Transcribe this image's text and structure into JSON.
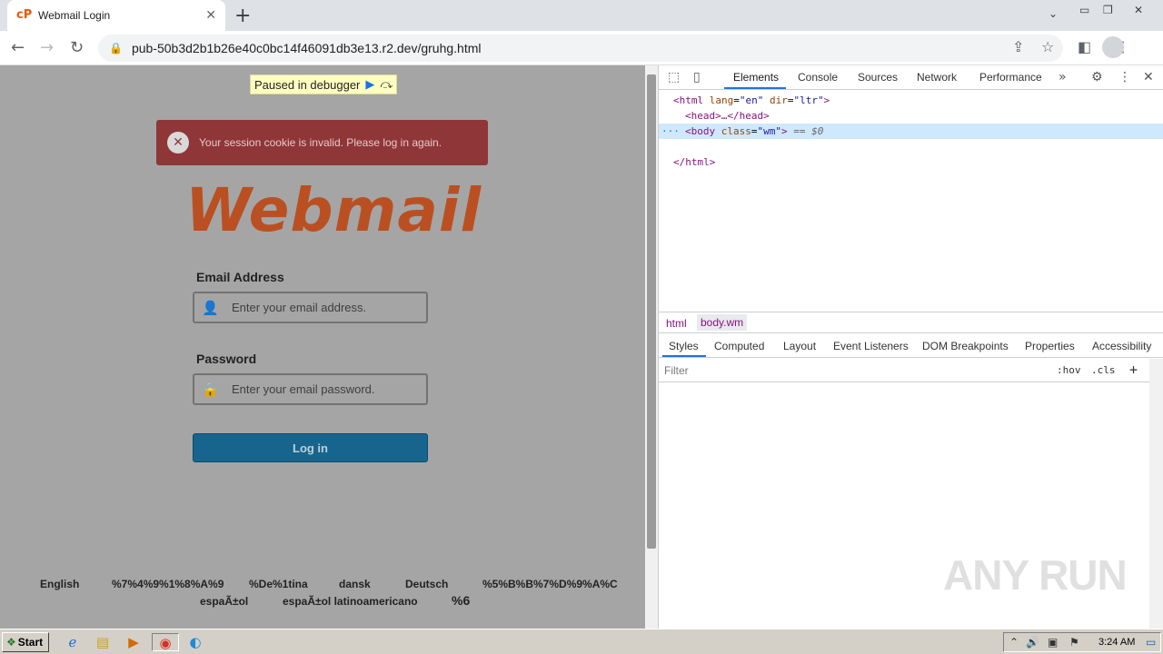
{
  "browser": {
    "tab_title": "Webmail Login",
    "tab_favicon": "cP",
    "url": "pub-50b3d2b1b26e40c0bc14f46091db3e13.r2.dev/gruhg.html"
  },
  "page": {
    "debugger_banner": "Paused in debugger",
    "alert_message": "Your session cookie is invalid. Please log in again.",
    "logo_text": "Webmail",
    "email_label": "Email Address",
    "email_placeholder": "Enter your email address.",
    "password_label": "Password",
    "password_placeholder": "Enter your email password.",
    "login_button": "Log in",
    "languages": [
      "English",
      "%7%4%9%1%8%A%9",
      "%De%1tina",
      "dansk",
      "Deutsch",
      "%5%B%B%7%D%9%A%C",
      "espaÃ±ol",
      "espaÃ±ol latinoamericano",
      "%6"
    ]
  },
  "devtools": {
    "tabs": [
      "Elements",
      "Console",
      "Sources",
      "Network",
      "Performance"
    ],
    "dom": {
      "html_open_tag": "<html",
      "html_attr1_name": "lang",
      "html_attr1_val": "\"en\"",
      "html_attr2_name": "dir",
      "html_attr2_val": "\"ltr\"",
      "html_open_end": ">",
      "head": "<head>…</head>",
      "ellipsis": "···",
      "body_open_tag": "<body",
      "body_attr_name": "class",
      "body_attr_val": "\"wm\"",
      "body_open_end": ">",
      "body_marker": " == $0",
      "html_close": "</html>"
    },
    "breadcrumbs": [
      "html",
      "body.wm"
    ],
    "subtabs": [
      "Styles",
      "Computed",
      "Layout",
      "Event Listeners",
      "DOM Breakpoints",
      "Properties",
      "Accessibility"
    ],
    "filter_placeholder": "Filter",
    "hov": ":hov",
    "cls": ".cls",
    "plus": "+"
  },
  "watermark": "ANY RUN",
  "taskbar": {
    "start_label": "Start",
    "clock": "3:24 AM"
  }
}
